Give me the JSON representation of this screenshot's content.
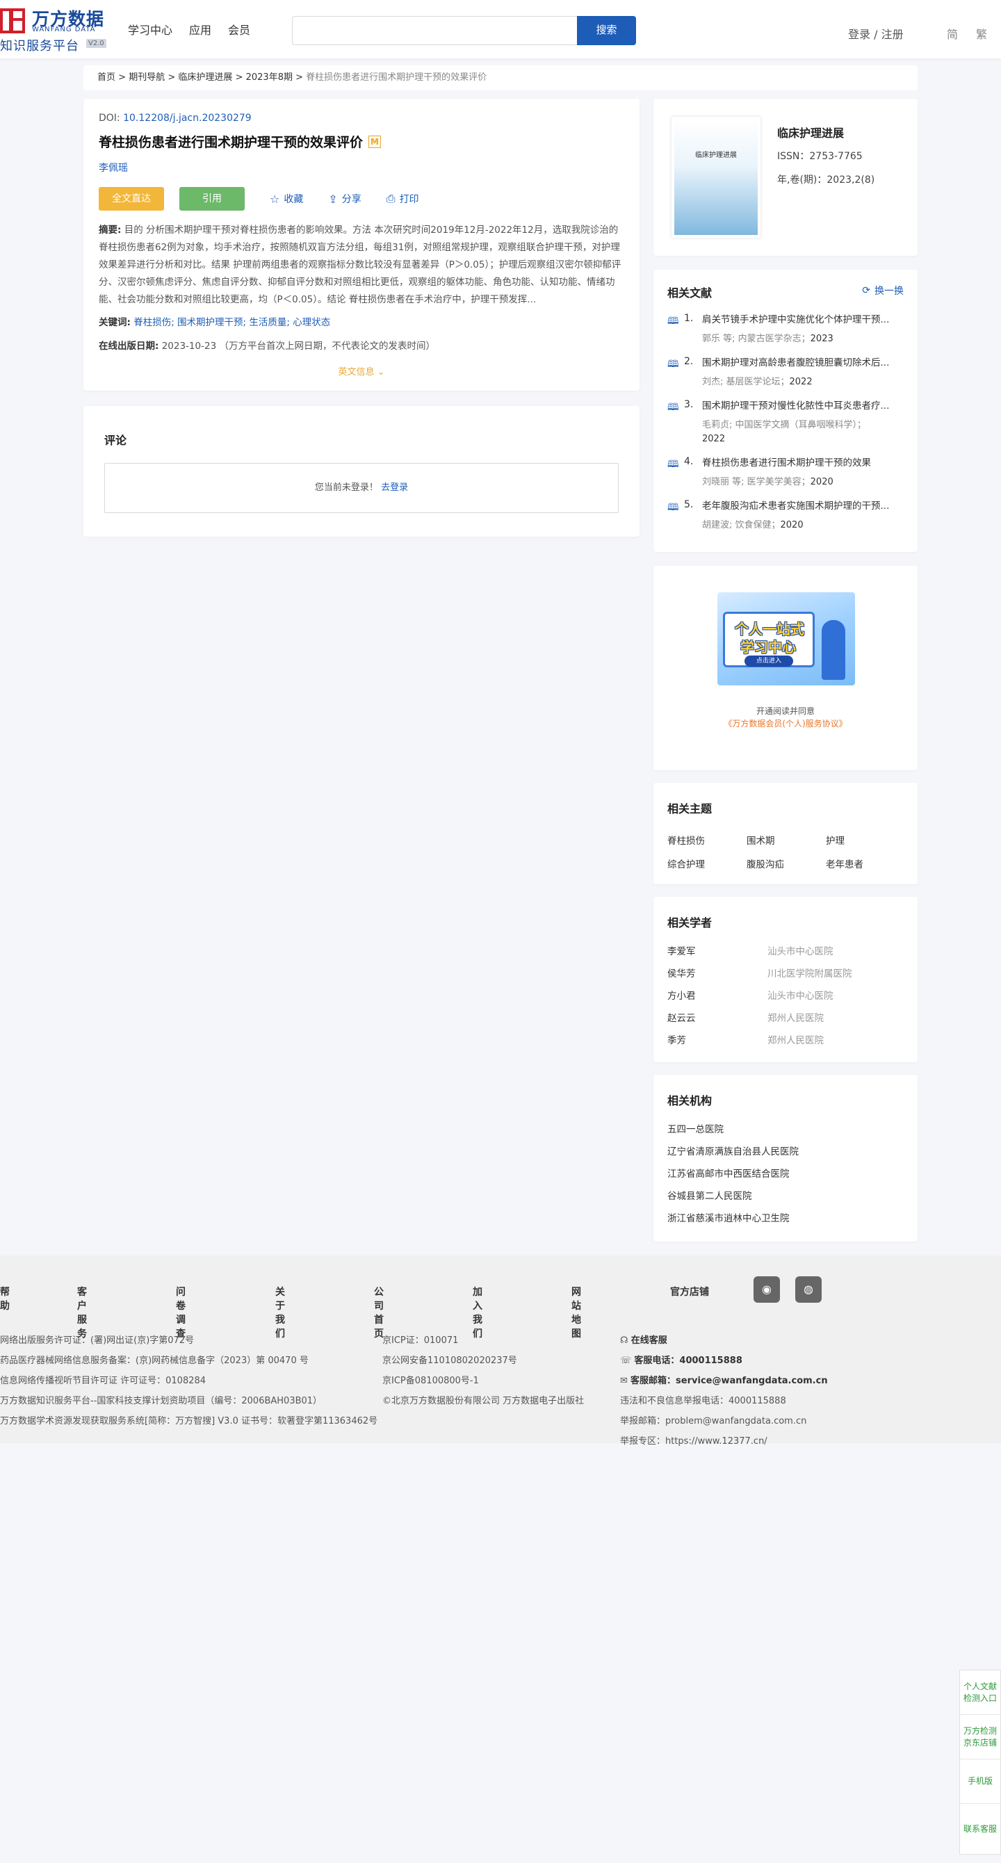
{
  "header": {
    "logo_cn": "万方数据",
    "logo_en": "WANFANG DATA",
    "logo_sub": "知识服务平台",
    "logo_ver": "V2.0",
    "nav": [
      "学习中心",
      "应用",
      "会员"
    ],
    "search_placeholder": "",
    "search_button": "搜索",
    "login": "登录 / 注册",
    "lang_simplified": "简",
    "lang_traditional": "繁"
  },
  "breadcrumb": {
    "items": [
      "首页",
      "期刊导航",
      "临床护理进展",
      "2023年8期"
    ],
    "separator": ">",
    "current": "脊柱损伤患者进行围术期护理干预的效果评价"
  },
  "article": {
    "doi_label": "DOI:",
    "doi": "10.12208/j.jacn.20230279",
    "title": "脊柱损伤患者进行围术期护理干预的效果评价",
    "badge": "M",
    "author": "李佩瑶",
    "btn_full": "全文直达",
    "btn_cite": "引用",
    "act_fav": "收藏",
    "act_share": "分享",
    "act_print": "打印",
    "abstract_label": "摘要:",
    "abstract": "目的 分析围术期护理干预对脊柱损伤患者的影响效果。方法 本次研究时间2019年12月-2022年12月，选取我院诊治的脊柱损伤患者62例为对象，均手术治疗，按照随机双盲方法分组，每组31例，对照组常规护理，观察组联合护理干预，对护理效果差异进行分析和对比。结果 护理前两组患者的观察指标分数比较没有显著差异（P＞0.05）；护理后观察组汉密尔顿抑郁评分、汉密尔顿焦虑评分、焦虑自评分数、抑郁自评分数和对照组相比更低，观察组的躯体功能、角色功能、认知功能、情绪功能、社会功能分数和对照组比较更高，均（P＜0.05）。结论 脊柱损伤患者在手术治疗中，护理干预发挥...",
    "keywords_label": "关键词:",
    "keywords": "脊柱损伤; 围术期护理干预; 生活质量; 心理状态",
    "pubdate_label": "在线出版日期:",
    "pubdate": "2023-10-23",
    "pubdate_note": "（万方平台首次上网日期，不代表论文的发表时间）",
    "en_info": "英文信息"
  },
  "comment": {
    "title": "评论",
    "prompt": "您当前未登录！",
    "login_link": "去登录"
  },
  "journal": {
    "cover_text": "临床护理进展",
    "name": "临床护理进展",
    "issn": "ISSN：2753-7765",
    "vol": "年,卷(期)：2023,2(8)"
  },
  "related": {
    "title": "相关文献",
    "swap": "换一换",
    "items": [
      {
        "num": "1.",
        "title": "肩关节镜手术护理中实施优化个体护理干预...",
        "meta": "郭乐 等; 内蒙古医学杂志；",
        "year": "2023"
      },
      {
        "num": "2.",
        "title": "围术期护理对高龄患者腹腔镜胆囊切除术后...",
        "meta": "刘杰; 基层医学论坛；",
        "year": "2022"
      },
      {
        "num": "3.",
        "title": "围术期护理干预对慢性化脓性中耳炎患者疗...",
        "meta": "毛莉贞; 中国医学文摘（耳鼻咽喉科学）；",
        "year": "2022"
      },
      {
        "num": "4.",
        "title": "脊柱损伤患者进行围术期护理干预的效果",
        "meta": "刘晓丽 等; 医学美学美容；",
        "year": "2020"
      },
      {
        "num": "5.",
        "title": "老年腹股沟疝术患者实施围术期护理的干预...",
        "meta": "胡建波; 饮食保健；",
        "year": "2020"
      }
    ]
  },
  "ad": {
    "line1": "个人一站式",
    "line2": "学习中心",
    "button": "点击进入",
    "note1": "开通阅读并同意",
    "note2": "《万方数据会员(个人)服务协议》"
  },
  "topics": {
    "title": "相关主题",
    "items": [
      "脊柱损伤",
      "围术期",
      "护理",
      "综合护理",
      "腹股沟疝",
      "老年患者"
    ]
  },
  "scholars": {
    "title": "相关学者",
    "items": [
      {
        "name": "李爱军",
        "org": "汕头市中心医院"
      },
      {
        "name": "侯华芳",
        "org": "川北医学院附属医院"
      },
      {
        "name": "方小君",
        "org": "汕头市中心医院"
      },
      {
        "name": "赵云云",
        "org": "郑州人民医院"
      },
      {
        "name": "季芳",
        "org": "郑州人民医院"
      }
    ]
  },
  "institutions": {
    "title": "相关机构",
    "items": [
      "五四一总医院",
      "辽宁省清原满族自治县人民医院",
      "江苏省高邮市中西医结合医院",
      "谷城县第二人民医院",
      "浙江省慈溪市逍林中心卫生院"
    ]
  },
  "footer": {
    "links": [
      "帮助",
      "客户服务",
      "问卷调查",
      "关于我们",
      "公司首页",
      "加入我们",
      "网站地图",
      "官方店铺"
    ],
    "col1": [
      "网络出版服务许可证：(署)网出证(京)字第072号",
      "药品医疗器械网络信息服务备案：(京)网药械信息备字（2023）第 00470 号",
      "信息网络传播视听节目许可证 许可证号：0108284",
      "万方数据知识服务平台--国家科技支撑计划资助项目（编号：2006BAH03B01）",
      "万方数据学术资源发现获取服务系统[简称：万方智搜] V3.0 证书号：软著登字第11363462号"
    ],
    "col2": [
      "京ICP证：010071",
      "京公网安备11010802020237号",
      "京ICP备08100800号-1",
      "©北京万方数据股份有限公司 万方数据电子出版社"
    ],
    "col3_service": "在线客服",
    "col3_phone_label": "客服电话：",
    "col3_phone": "4000115888",
    "col3_email_label": "客服邮箱：",
    "col3_email": "service@wanfangdata.com.cn",
    "col3_lines": [
      "违法和不良信息举报电话：4000115888",
      "举报邮箱：problem@wanfangdata.com.cn",
      "举报专区：https://www.12377.cn/"
    ]
  },
  "side_tools": [
    "个人文献检测入口",
    "万方检测京东店铺",
    "手机版",
    "联系客服"
  ]
}
